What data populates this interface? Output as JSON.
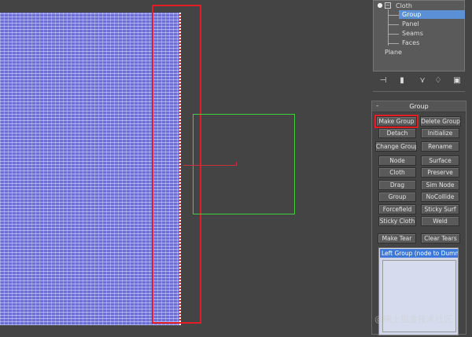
{
  "scene_tree": {
    "items": [
      {
        "label": "Cloth"
      },
      {
        "label": "Group"
      },
      {
        "label": "Panel"
      },
      {
        "label": "Seams"
      },
      {
        "label": "Faces"
      },
      {
        "label": "Plane"
      }
    ],
    "selected_item": "Group"
  },
  "toolbar": {
    "icons": [
      "pin-icon",
      "modifier-stack-icon",
      "make-unique-icon",
      "remove-modifier-icon",
      "configure-modifier-sets-icon"
    ]
  },
  "rollout": {
    "collapse_sign": "-",
    "title": "Group",
    "buttons": {
      "make_group": "Make Group",
      "delete_group": "Delete Group",
      "detach": "Detach",
      "initialize": "Initialize",
      "change_group": "Change Group",
      "rename": "Rename",
      "node": "Node",
      "surface": "Surface",
      "cloth": "Cloth",
      "preserve": "Preserve",
      "drag": "Drag",
      "sim_node": "Sim Node",
      "group": "Group",
      "nocollide": "NoCollide",
      "forcefield": "Forcefield",
      "sticky_surf": "Sticky Surf",
      "sticky_cloth": "Sticky Cloth",
      "weld": "Weld",
      "make_tear": "Make Tear",
      "clear_tears": "Clear Tears"
    },
    "highlighted_button": "Make Group",
    "group_list": {
      "items": [
        "Left Group (node  to  Dumm"
      ]
    }
  },
  "watermark": "@稀土掘金技术社区",
  "colors": {
    "viewport_bg": "#444444",
    "cloth_mesh": "#6c6fd6",
    "selection_highlight": "#e31c25",
    "helper_box": "#3fcf3f",
    "tree_selected": "#5b8fd6"
  }
}
